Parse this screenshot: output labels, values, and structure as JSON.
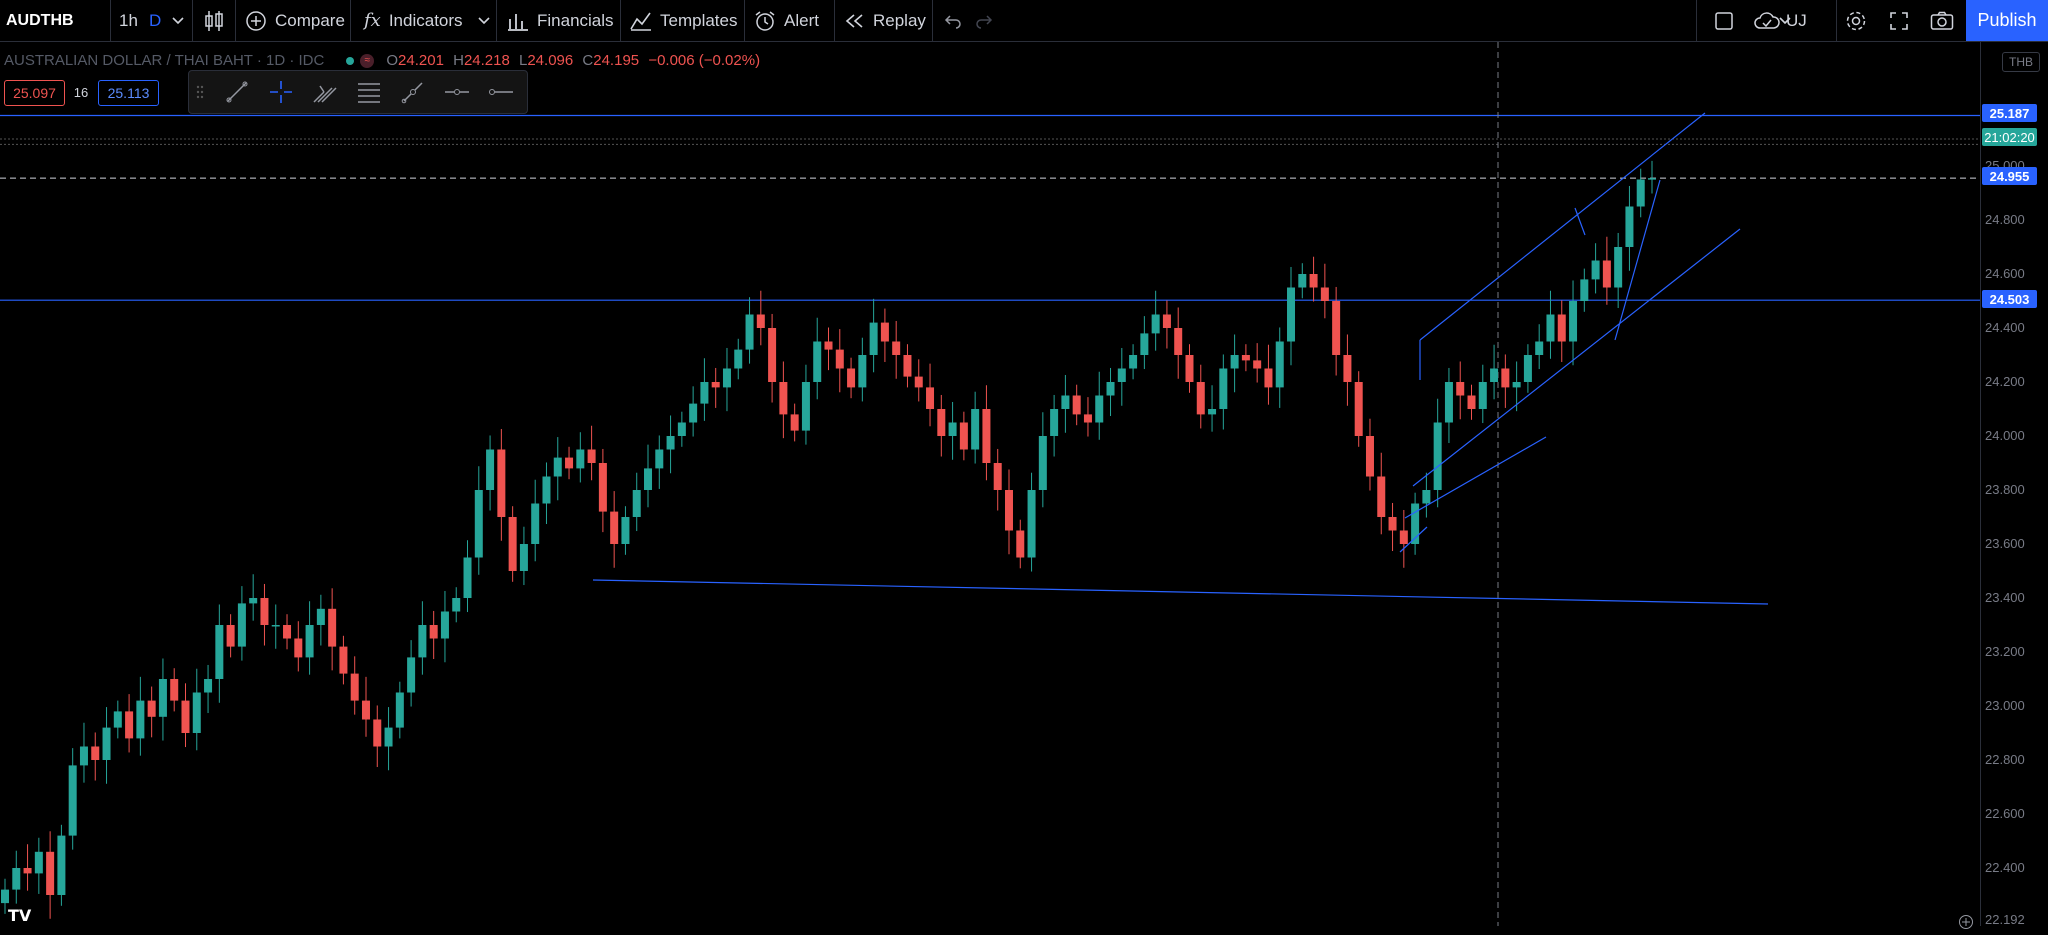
{
  "toolbar": {
    "symbol": "AUDTHB",
    "interval": "1h",
    "interval_d": "D",
    "compare_label": "Compare",
    "indicators_label": "Indicators",
    "financials_label": "Financials",
    "templates_label": "Templates",
    "alert_label": "Alert",
    "replay_label": "Replay",
    "account_label": "UJ",
    "publish_label": "Publish"
  },
  "legend": {
    "name": "AUSTRALIAN DOLLAR / THAI BAHT · 1D · IDC",
    "open_label": "O",
    "open": "24.201",
    "high_label": "H",
    "high": "24.218",
    "low_label": "L",
    "low": "24.096",
    "close_label": "C",
    "close": "24.195",
    "change": "−0.006 (−0.02%)"
  },
  "trade": {
    "sell": "25.097",
    "spread": "16",
    "buy": "25.113"
  },
  "currency": "THB",
  "price_axis": {
    "labels": [
      "25.000",
      "24.800",
      "24.600",
      "24.400",
      "24.200",
      "24.000",
      "23.800",
      "23.600",
      "23.400",
      "23.200",
      "23.000",
      "22.800",
      "22.600",
      "22.400"
    ],
    "bottom_label": "22.192"
  },
  "price_tags": {
    "top_line": "25.187",
    "countdown": "21:02:20",
    "current": "24.955",
    "resistance": "24.503"
  },
  "colors": {
    "up": "#26a69a",
    "down": "#ef5350",
    "lines": "#2962ff",
    "accent": "#2962ff",
    "background": "#000000"
  },
  "chart_data": {
    "type": "candlestick",
    "symbol": "AUDTHB",
    "timeframe": "1D",
    "ylim": [
      22.19,
      25.4
    ],
    "close_series": [
      22.32,
      22.4,
      22.38,
      22.46,
      22.3,
      22.52,
      22.78,
      22.85,
      22.8,
      22.92,
      22.98,
      22.88,
      23.02,
      22.96,
      23.1,
      23.02,
      22.9,
      23.05,
      23.1,
      23.3,
      23.22,
      23.38,
      23.4,
      23.3,
      23.3,
      23.25,
      23.18,
      23.3,
      23.36,
      23.22,
      23.12,
      23.02,
      22.95,
      22.85,
      22.92,
      23.05,
      23.18,
      23.3,
      23.25,
      23.35,
      23.4,
      23.55,
      23.8,
      23.95,
      23.7,
      23.5,
      23.6,
      23.75,
      23.85,
      23.92,
      23.88,
      23.95,
      23.9,
      23.72,
      23.6,
      23.7,
      23.8,
      23.88,
      23.95,
      24.0,
      24.05,
      24.12,
      24.2,
      24.18,
      24.25,
      24.32,
      24.45,
      24.4,
      24.2,
      24.08,
      24.02,
      24.2,
      24.35,
      24.32,
      24.25,
      24.18,
      24.3,
      24.42,
      24.35,
      24.3,
      24.22,
      24.18,
      24.1,
      24.0,
      24.05,
      23.95,
      24.1,
      23.9,
      23.8,
      23.65,
      23.55,
      23.8,
      24.0,
      24.1,
      24.15,
      24.08,
      24.05,
      24.15,
      24.2,
      24.25,
      24.3,
      24.38,
      24.45,
      24.4,
      24.3,
      24.2,
      24.08,
      24.1,
      24.25,
      24.3,
      24.28,
      24.25,
      24.18,
      24.35,
      24.55,
      24.6,
      24.55,
      24.5,
      24.3,
      24.2,
      24.0,
      23.85,
      23.7,
      23.65,
      23.6,
      23.75,
      23.8,
      24.05,
      24.2,
      24.15,
      24.1,
      24.2,
      24.25,
      24.18,
      24.2,
      24.3,
      24.35,
      24.45,
      24.35,
      24.5,
      24.58,
      24.65,
      24.55,
      24.7,
      24.85,
      24.95,
      24.955
    ]
  }
}
